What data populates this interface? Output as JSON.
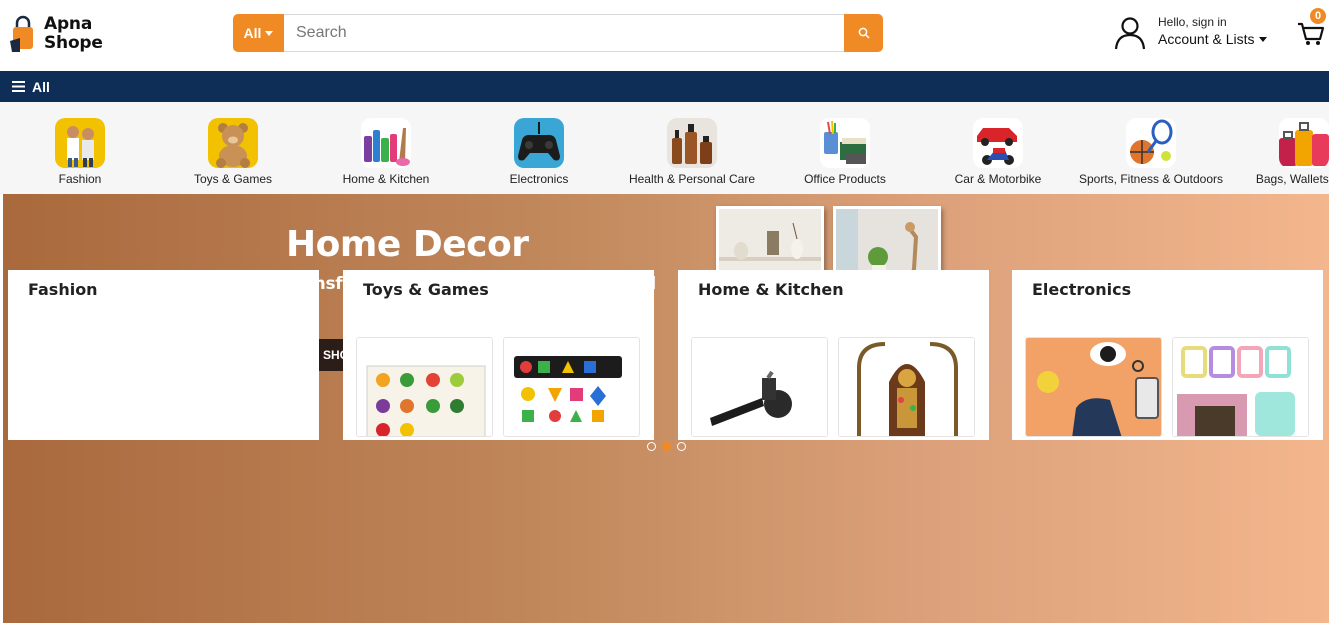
{
  "brand": {
    "line1": "Apna",
    "line2": "Shope"
  },
  "search": {
    "category": "All",
    "placeholder": "Search"
  },
  "account": {
    "greeting": "Hello, sign in",
    "label": "Account & Lists"
  },
  "cart": {
    "count": "0"
  },
  "nav": {
    "all_label": "All"
  },
  "categories": [
    {
      "label": "Fashion"
    },
    {
      "label": "Toys & Games"
    },
    {
      "label": "Home & Kitchen"
    },
    {
      "label": "Electronics"
    },
    {
      "label": "Health & Personal Care"
    },
    {
      "label": "Office Products"
    },
    {
      "label": "Car & Motorbike"
    },
    {
      "label": "Sports, Fitness & Outdoors"
    },
    {
      "label": "Bags, Wallets and"
    }
  ],
  "banner": {
    "title": "Home Decor",
    "subtitle": "Transform Your Home, Inspire Your Soul",
    "cta": "SHOP NOW",
    "active_slide": 2,
    "slide_count": 3
  },
  "cards": [
    {
      "title": "Fashion"
    },
    {
      "title": "Toys & Games"
    },
    {
      "title": "Home & Kitchen"
    },
    {
      "title": "Electronics"
    }
  ],
  "colors": {
    "accent": "#f08a24",
    "navbar": "#0e2e57"
  }
}
